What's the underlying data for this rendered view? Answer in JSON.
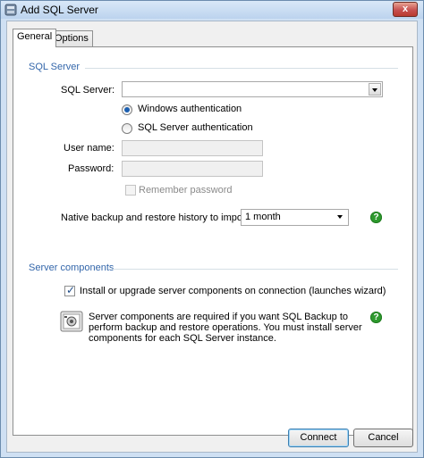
{
  "window": {
    "title": "Add SQL Server",
    "close_glyph": "x",
    "title_icon": "app-icon"
  },
  "tabs": [
    {
      "label": "General",
      "selected": true
    },
    {
      "label": "Options",
      "selected": false
    }
  ],
  "sql_server_section": {
    "title": "SQL Server",
    "server_label": "SQL Server:",
    "server_value": "",
    "auth_windows_label": "Windows authentication",
    "auth_sql_label": "SQL Server authentication",
    "selected_auth": "Windows authentication",
    "username_label": "User name:",
    "username_value": "",
    "password_label": "Password:",
    "password_value": "",
    "remember_label": "Remember password",
    "remember_checked": false,
    "history_label": "Native backup and restore history to import:",
    "history_value": "1 month",
    "help_glyph": "?"
  },
  "components_section": {
    "title": "Server components",
    "install_label": "Install or upgrade server components on connection (launches wizard)",
    "install_checked": true,
    "check_glyph": "✓",
    "info_text": "Server components are required if you want SQL Backup to perform backup and restore operations. You must install server components for each SQL Server instance.",
    "help_glyph": "?",
    "info_icon": "server-component-icon"
  },
  "footer": {
    "connect_label": "Connect",
    "cancel_label": "Cancel"
  },
  "colors": {
    "section_title": "#3366aa",
    "help_green": "#2e9a2e",
    "close_red": "#c75050"
  }
}
